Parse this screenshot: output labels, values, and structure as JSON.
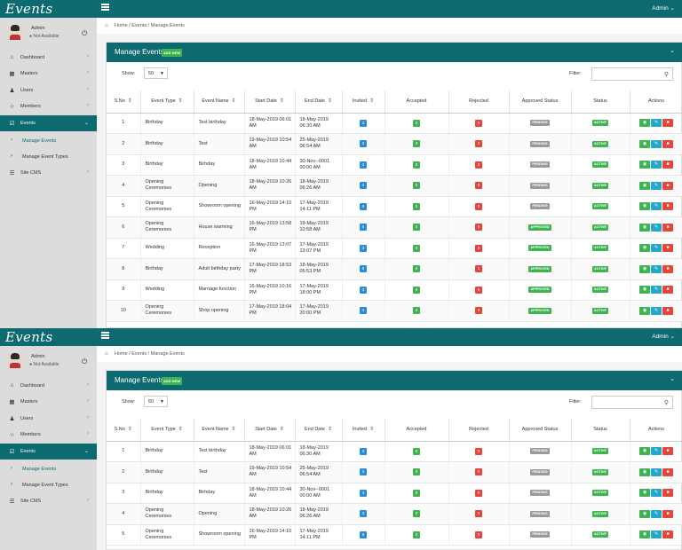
{
  "app": {
    "logo": "Events",
    "menu_icon": "hamburger-icon",
    "admin_label": "Admin"
  },
  "sidebar": {
    "user_name": "Admin",
    "user_status": "Not Available",
    "power_icon": "power-icon",
    "items": [
      {
        "label": "Dashboard",
        "icon": "home-icon"
      },
      {
        "label": "Masters",
        "icon": "grid-icon"
      },
      {
        "label": "Users",
        "icon": "users-icon"
      },
      {
        "label": "Members",
        "icon": "trophy-icon"
      },
      {
        "label": "Events",
        "icon": "checkbox-icon"
      },
      {
        "label": "Manage Events"
      },
      {
        "label": "Manage Event Types"
      },
      {
        "label": "Site CMS",
        "icon": "sliders-icon"
      }
    ]
  },
  "breadcrumb": {
    "path": "Home  /  Events  /  Manage Events"
  },
  "panel": {
    "title": "Manage Events",
    "add_new": "ADD NEW",
    "show_label": "Show:",
    "show_value": "50",
    "filter_label": "Filter:"
  },
  "table": {
    "headers": [
      "S.No",
      "Event Type",
      "Event Name",
      "Start Date",
      "End Date",
      "Invited",
      "Accepted",
      "Rejected",
      "Approved Status",
      "Status",
      "Actions"
    ],
    "rows": [
      {
        "sno": "1",
        "type": "Birthday",
        "name": "Test birthday",
        "start": "18-May-2019 06:01 AM",
        "end": "18-May-2019 06:30 AM",
        "invited": "3",
        "accepted": "0",
        "rejected": "0",
        "approved": "PENDING",
        "status": "ACTIVE"
      },
      {
        "sno": "2",
        "type": "Birthday",
        "name": "Test",
        "start": "19-May-2019 10:54 AM",
        "end": "25-May-2019 06:54 AM",
        "invited": "3",
        "accepted": "0",
        "rejected": "0",
        "approved": "PENDING",
        "status": "ACTIVE"
      },
      {
        "sno": "3",
        "type": "Birthday",
        "name": "Birhday",
        "start": "18-May-2019 10:44 AM",
        "end": "30-Nov--0001 00:00 AM",
        "invited": "3",
        "accepted": "0",
        "rejected": "0",
        "approved": "PENDING",
        "status": "ACTIVE"
      },
      {
        "sno": "4",
        "type": "Opening Ceremonies",
        "name": "Opening",
        "start": "18-May-2019 10:26 AM",
        "end": "18-May-2019 06:26 AM",
        "invited": "3",
        "accepted": "0",
        "rejected": "0",
        "approved": "PENDING",
        "status": "ACTIVE"
      },
      {
        "sno": "5",
        "type": "Opening Ceremonies",
        "name": "Showroom opening",
        "start": "16-May-2019 14:10 PM",
        "end": "17-May-2019 14:11 PM",
        "invited": "6",
        "accepted": "0",
        "rejected": "0",
        "approved": "PENDING",
        "status": "ACTIVE"
      },
      {
        "sno": "6",
        "type": "Opening Ceremonies",
        "name": "House warming",
        "start": "16-May-2019 13:58 PM",
        "end": "19-May-2019 10:58 AM",
        "invited": "5",
        "accepted": "0",
        "rejected": "0",
        "approved": "APPROVED",
        "status": "ACTIVE"
      },
      {
        "sno": "7",
        "type": "Wedding",
        "name": "Reception",
        "start": "16-May-2019 13:07 PM",
        "end": "17-May-2019 13:07 PM",
        "invited": "3",
        "accepted": "0",
        "rejected": "0",
        "approved": "APPROVED",
        "status": "ACTIVE"
      },
      {
        "sno": "8",
        "type": "Birthday",
        "name": "Adult birthday party",
        "start": "17-May-2019 18:53 PM",
        "end": "18-May-2019 05:53 PM",
        "invited": "5",
        "accepted": "0",
        "rejected": "1",
        "approved": "APPROVED",
        "status": "ACTIVE"
      },
      {
        "sno": "9",
        "type": "Wedding",
        "name": "Marriage function",
        "start": "16-May-2019 10:16 PM",
        "end": "17-May-2019 18:00 PM",
        "invited": "3",
        "accepted": "0",
        "rejected": "0",
        "approved": "APPROVED",
        "status": "ACTIVE"
      },
      {
        "sno": "10",
        "type": "Opening Ceremonies",
        "name": "Shop opening",
        "start": "17-May-2019 18:04 PM",
        "end": "17-May-2019 20:00 PM",
        "invited": "4",
        "accepted": "2",
        "rejected": "0",
        "approved": "APPROVED",
        "status": "ACTIVE"
      }
    ],
    "row_count_second_capture": 5
  },
  "colors": {
    "accent": "#0d6a71",
    "blue": "#2a8cdc",
    "green": "#3fb34f",
    "red": "#e8443a",
    "pending": "#9a9a9a",
    "teal": "#22a8c9"
  }
}
